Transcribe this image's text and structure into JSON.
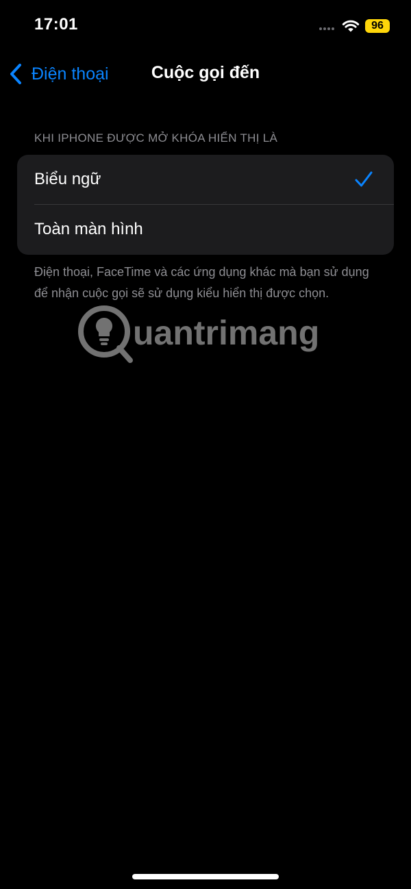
{
  "status_bar": {
    "time": "17:01",
    "battery_level": "96",
    "battery_color": "#ffd60a"
  },
  "nav": {
    "back_label": "Điện thoại",
    "title": "Cuộc gọi đến"
  },
  "section": {
    "header": "KHI IPHONE ĐƯỢC MỞ KHÓA HIỂN THỊ LÀ",
    "options": [
      {
        "label": "Biểu ngữ",
        "selected": true
      },
      {
        "label": "Toàn màn hình",
        "selected": false
      }
    ],
    "footer": "Điện thoại, FaceTime và các ứng dụng khác mà bạn sử dụng để nhận cuộc gọi sẽ sử dụng kiểu hiển thị được chọn."
  },
  "watermark": {
    "text": "uantrimang",
    "icon": "lightbulb-logo-icon"
  },
  "colors": {
    "accent": "#0a84ff",
    "background": "#000000",
    "group_background": "#1c1c1e",
    "secondary_text": "#8e8e93"
  },
  "icons": {
    "back": "chevron-left-icon",
    "wifi": "wifi-icon",
    "check": "checkmark-icon",
    "signal": "signal-dots-icon"
  }
}
